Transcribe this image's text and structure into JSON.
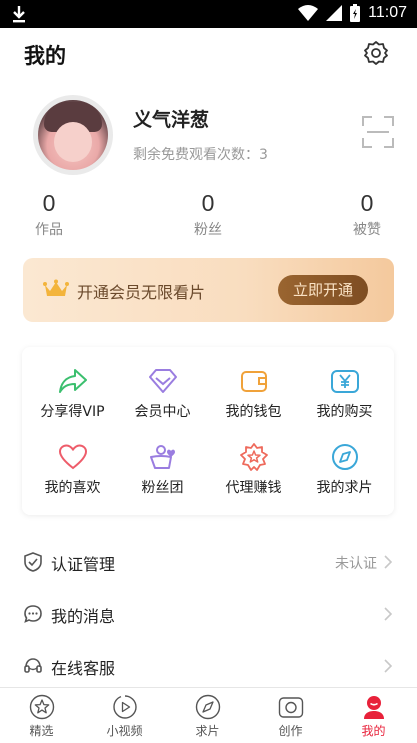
{
  "status_bar": {
    "time": "11:07"
  },
  "header": {
    "title": "我的"
  },
  "profile": {
    "username": "义气洋葱",
    "free_views_hint": "剩余免费观看次数：3"
  },
  "stats": [
    {
      "value": "0",
      "label": "作品"
    },
    {
      "value": "0",
      "label": "粉丝"
    },
    {
      "value": "0",
      "label": "被赞"
    }
  ],
  "vip_banner": {
    "text": "开通会员无限看片",
    "button": "立即开通"
  },
  "grid": [
    {
      "label": "分享得VIP",
      "icon": "share-icon",
      "color": "#3bbf6e"
    },
    {
      "label": "会员中心",
      "icon": "diamond-icon",
      "color": "#9a7de0"
    },
    {
      "label": "我的钱包",
      "icon": "wallet-icon",
      "color": "#f0a23a"
    },
    {
      "label": "我的购买",
      "icon": "yen-icon",
      "color": "#3aa7d8"
    },
    {
      "label": "我的喜欢",
      "icon": "heart-icon",
      "color": "#ee5c6a"
    },
    {
      "label": "粉丝团",
      "icon": "fan-group-icon",
      "color": "#9a7de0"
    },
    {
      "label": "代理赚钱",
      "icon": "agent-badge-icon",
      "color": "#ee6a5c"
    },
    {
      "label": "我的求片",
      "icon": "compass-icon",
      "color": "#3aa7d8"
    }
  ],
  "list": [
    {
      "label": "认证管理",
      "value": "未认证",
      "icon": "shield-check-icon"
    },
    {
      "label": "我的消息",
      "value": "",
      "icon": "message-icon"
    },
    {
      "label": "在线客服",
      "value": "",
      "icon": "headset-icon"
    }
  ],
  "tabs": [
    {
      "label": "精选",
      "icon": "star-icon"
    },
    {
      "label": "小视频",
      "icon": "video-icon"
    },
    {
      "label": "求片",
      "icon": "compass-icon"
    },
    {
      "label": "创作",
      "icon": "camera-icon"
    },
    {
      "label": "我的",
      "icon": "profile-icon"
    }
  ],
  "colors": {
    "accent": "#e8213a",
    "vip_button": "#8a5628"
  }
}
